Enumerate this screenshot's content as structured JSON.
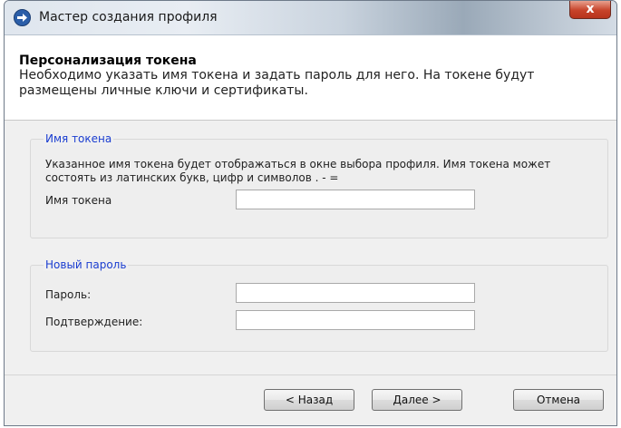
{
  "window": {
    "title": "Мастер создания профиля",
    "close_label": "x",
    "accent_color": "#2b5ea8",
    "close_color": "#c7432a"
  },
  "header": {
    "title": "Персонализация токена",
    "description": "Необходимо указать имя токена и задать пароль для него. На токене будут размещены личные ключи и сертификаты."
  },
  "token_group": {
    "legend": "Имя токена",
    "description": "Указанное имя токена будет отображаться в окне выбора профиля. Имя токена может состоять из латинских букв, цифр и символов . - =",
    "field_label": "Имя токена",
    "field_value": ""
  },
  "password_group": {
    "legend": "Новый пароль",
    "password_label": "Пароль:",
    "password_value": "",
    "confirm_label": "Подтверждение:",
    "confirm_value": ""
  },
  "buttons": {
    "back": "< Назад",
    "next": "Далее >",
    "cancel": "Отмена"
  }
}
